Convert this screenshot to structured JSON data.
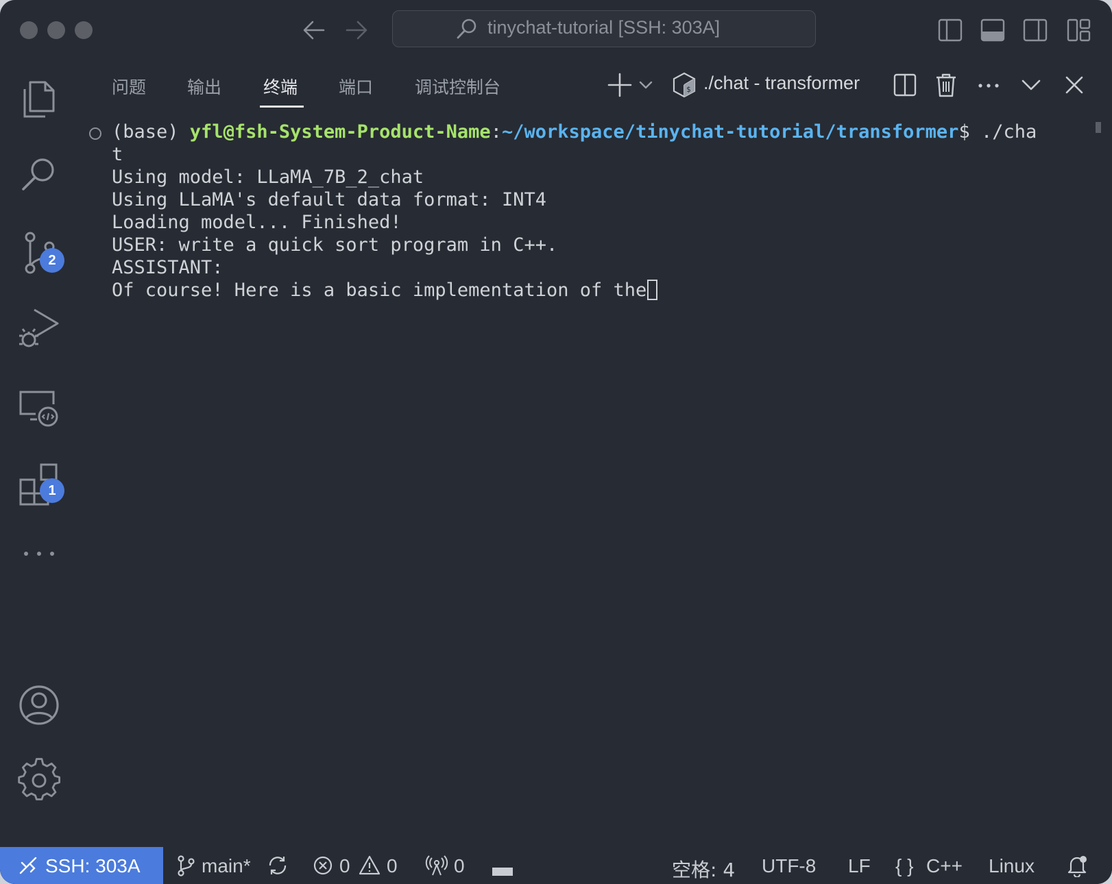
{
  "window": {
    "command_center": "tinychat-tutorial [SSH: 303A]"
  },
  "activity_bar": {
    "items": [
      {
        "icon": "files-icon"
      },
      {
        "icon": "search-icon"
      },
      {
        "icon": "source-control-icon",
        "badge": "2"
      },
      {
        "icon": "run-debug-icon"
      },
      {
        "icon": "remote-explorer-icon"
      },
      {
        "icon": "extensions-icon",
        "badge": "1"
      },
      {
        "icon": "more-icon"
      }
    ],
    "bottom": [
      {
        "icon": "account-icon"
      },
      {
        "icon": "settings-gear-icon"
      }
    ]
  },
  "panel": {
    "tabs": [
      "问题",
      "输出",
      "终端",
      "端口",
      "调试控制台"
    ],
    "active_tab": "终端",
    "terminal_name": "./chat - transformer"
  },
  "terminal": {
    "prompt_prefix": "(base) ",
    "prompt_user": "yfl@fsh-System-Product-Name",
    "prompt_colon": ":",
    "prompt_path": "~/workspace/tinychat-tutorial/transformer",
    "prompt_dollar": "$ ./cha",
    "wrap": "t",
    "lines": [
      "Using model: LLaMA_7B_2_chat",
      "Using LLaMA's default data format: INT4",
      "Loading model... Finished!",
      "USER: write a quick sort program in C++.",
      "ASSISTANT:",
      "Of course! Here is a basic implementation of the"
    ]
  },
  "status_bar": {
    "remote": "SSH: 303A",
    "branch": "main*",
    "errors": "0",
    "warnings": "0",
    "ports": "0",
    "spaces": "空格: 4",
    "encoding": "UTF-8",
    "eol": "LF",
    "language_braces": "{ }",
    "language": "C++",
    "os": "Linux"
  },
  "colors": {
    "background": "#272b33",
    "accent": "#4b7bdc",
    "prompt_user": "#a6e36b",
    "prompt_path": "#5ab4f0"
  }
}
